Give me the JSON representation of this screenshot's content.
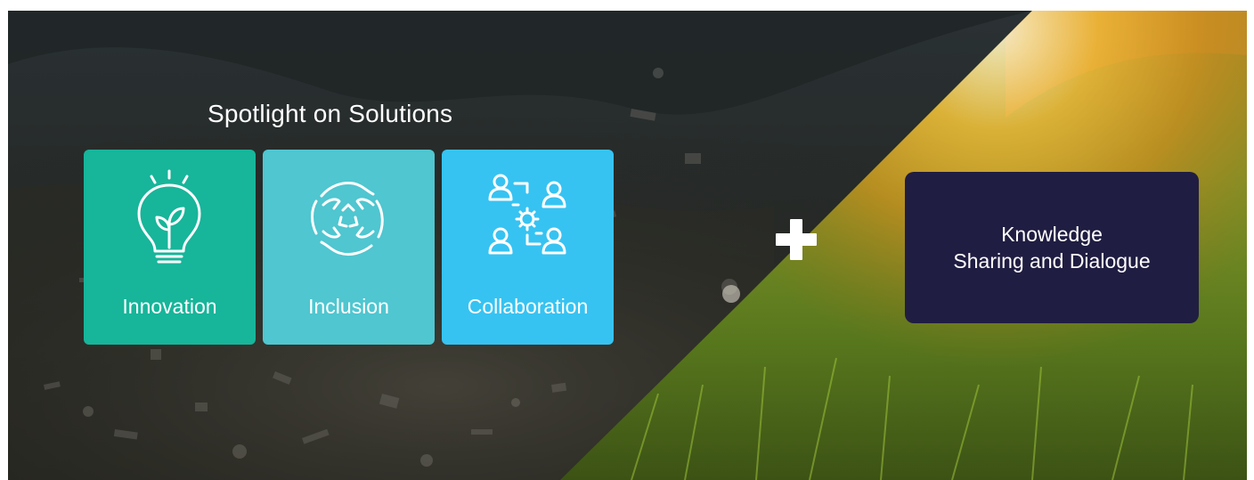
{
  "headline": "Spotlight on Solutions",
  "cards": [
    {
      "label": "Innovation",
      "icon": "lightbulb-seedling-icon",
      "color": "#17b59a"
    },
    {
      "label": "Inclusion",
      "icon": "hands-globe-recycle-icon",
      "color": "#4fc6d0"
    },
    {
      "label": "Collaboration",
      "icon": "team-network-gear-icon",
      "color": "#36c3f2"
    }
  ],
  "plus_icon": "plus-icon",
  "knowledge": {
    "line1": "Knowledge",
    "line2": "Sharing and Dialogue",
    "color": "#201d42"
  },
  "colors": {
    "dark_overlay": "#1a1f1d",
    "sunlight": "#f2b83a",
    "grass": "#6f9a2a"
  }
}
